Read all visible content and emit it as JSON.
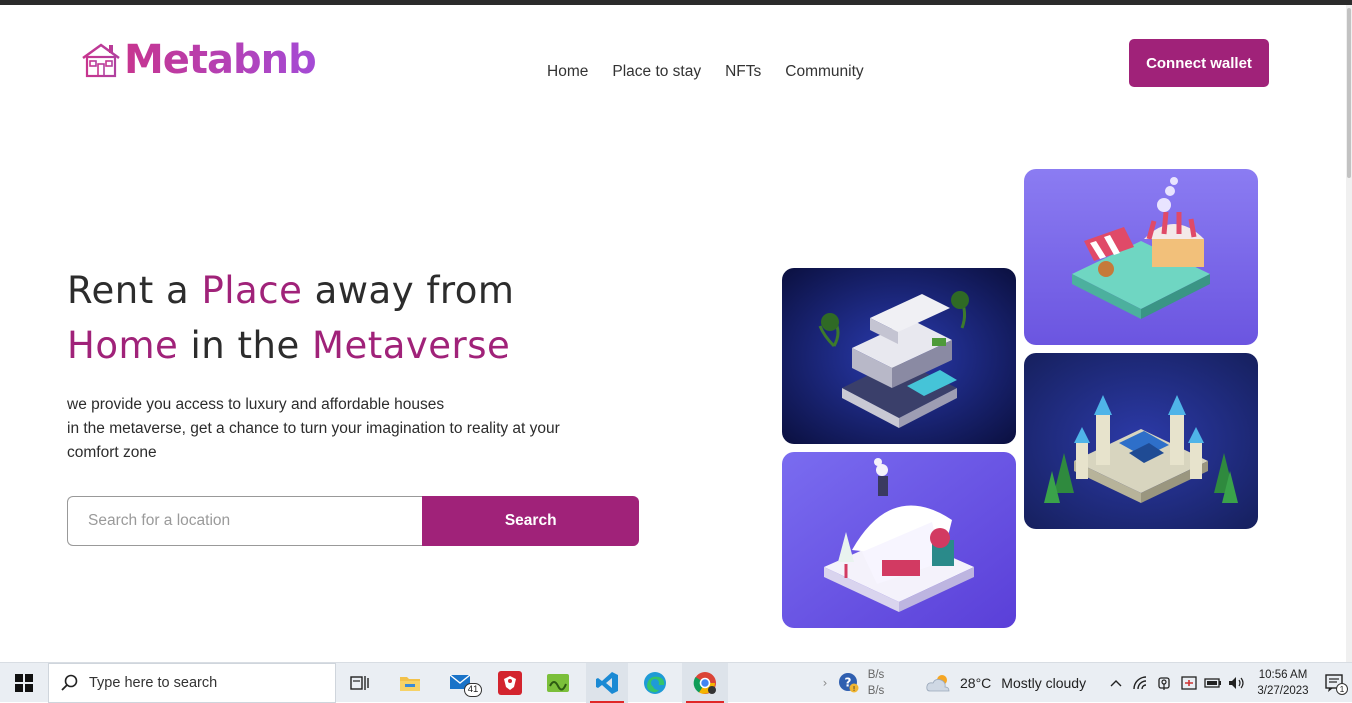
{
  "header": {
    "logo_text": "Metabnb",
    "logo_icon": "house-icon",
    "nav": [
      "Home",
      "Place to stay",
      "NFTs",
      "Community"
    ],
    "connect_label": "Connect wallet"
  },
  "hero": {
    "line1": {
      "a": "Rent a ",
      "b": "Place",
      "c": " away from"
    },
    "line2": {
      "a": "Home",
      "b": " in the ",
      "c": "Metaverse"
    },
    "desc_lines": [
      "we provide you access to luxury and affordable houses",
      "in the metaverse, get a chance to turn your imagination to reality at your",
      "comfort zone"
    ],
    "search_placeholder": "Search for a location",
    "search_label": "Search"
  },
  "gallery": [
    {
      "name": "modern-villa-image"
    },
    {
      "name": "market-stall-image"
    },
    {
      "name": "castle-image"
    },
    {
      "name": "winter-cottage-image"
    }
  ],
  "colors": {
    "accent": "#a02279",
    "logo_start": "#c7358f",
    "logo_end": "#a44bd6"
  },
  "taskbar": {
    "search_placeholder": "Type here to search",
    "mail_badge": "41",
    "net_up": "B/s",
    "net_down": "B/s",
    "weather_temp": "28°C",
    "weather_desc": "Mostly cloudy",
    "time": "10:56 AM",
    "date": "3/27/2023",
    "notifications": "1",
    "icons": [
      "windows-icon",
      "search-icon",
      "task-view-icon",
      "file-explorer-icon",
      "mail-icon",
      "red-app-icon",
      "green-app-icon",
      "vscode-icon",
      "edge-icon",
      "chrome-icon"
    ]
  }
}
